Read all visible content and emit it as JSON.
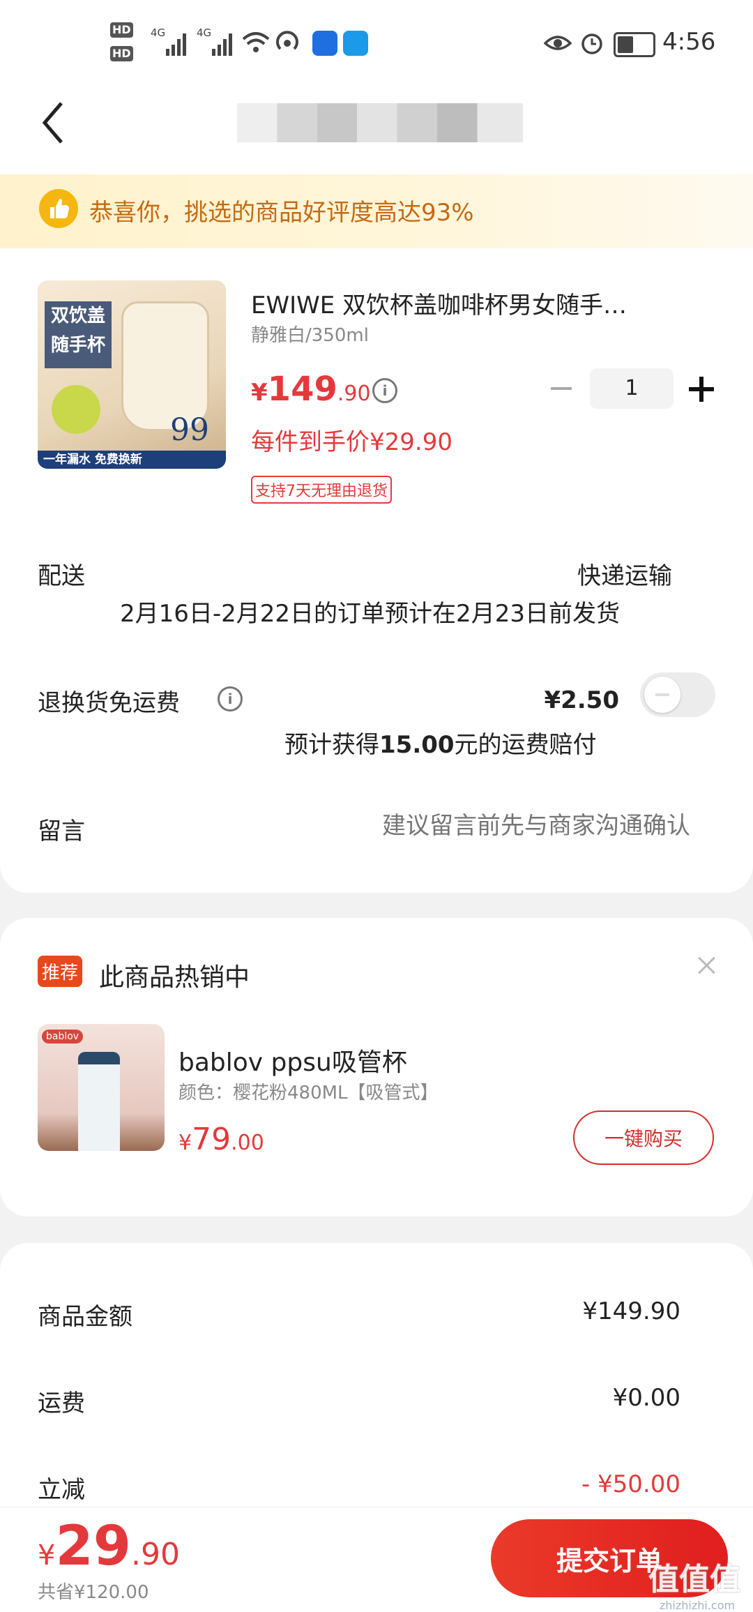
{
  "status_bar": {
    "time": "4:56",
    "hd1": "HD",
    "hd2": "HD",
    "net1": "4G",
    "net2": "4G"
  },
  "nav": {
    "back_icon": "chevron-left-icon"
  },
  "banner": {
    "text": "恭喜你，挑选的商品好评度高达93%",
    "icon": "thumbs-up-icon"
  },
  "product": {
    "title": "EWIWE 双饮杯盖咖啡杯男女随手…",
    "spec": "静雅白/350ml",
    "price_currency": "¥",
    "price_int": "149",
    "price_dec": ".90",
    "quantity": "1",
    "final_price": "每件到手价¥29.90",
    "badge": "支持7天无理由退货",
    "image_text": {
      "tag": "双饮盖随手杯",
      "bottom": "一年漏水 免费换新",
      "price": "99"
    }
  },
  "delivery": {
    "label": "配送",
    "value": "快递运输",
    "note": "2月16日-2月22日的订单预计在2月23日前发货"
  },
  "return_insurance": {
    "label": "退换货免运费",
    "price": "¥2.50",
    "note_prefix": "预计获得",
    "note_amount": "15.00",
    "note_suffix": "元的运费赔付",
    "enabled": false
  },
  "message": {
    "label": "留言",
    "placeholder": "建议留言前先与商家沟通确认"
  },
  "recommend": {
    "tag": "推荐",
    "title": "此商品热销中",
    "image_logo": "bablov",
    "name": "bablov ppsu吸管杯",
    "spec": "颜色：樱花粉480ML【吸管式】",
    "price_currency": "¥",
    "price_int": "79",
    "price_dec": ".00",
    "buy_label": "一键购买"
  },
  "summary": {
    "rows": [
      {
        "label": "商品金额",
        "value": "¥149.90"
      },
      {
        "label": "运费",
        "value": "¥0.00"
      },
      {
        "label": "立减",
        "value": "- ¥50.00"
      }
    ]
  },
  "bottom_bar": {
    "currency": "¥",
    "total_int": "29",
    "total_dec": ".90",
    "saved": "共省¥120.00",
    "submit_label": "提交订单"
  },
  "watermark": {
    "text": "值值值",
    "sub": "zhizhizhi.com"
  },
  "colors": {
    "accent": "#e4393c",
    "banner_text": "#c66a10",
    "banner_bg": "#fff2cc"
  }
}
